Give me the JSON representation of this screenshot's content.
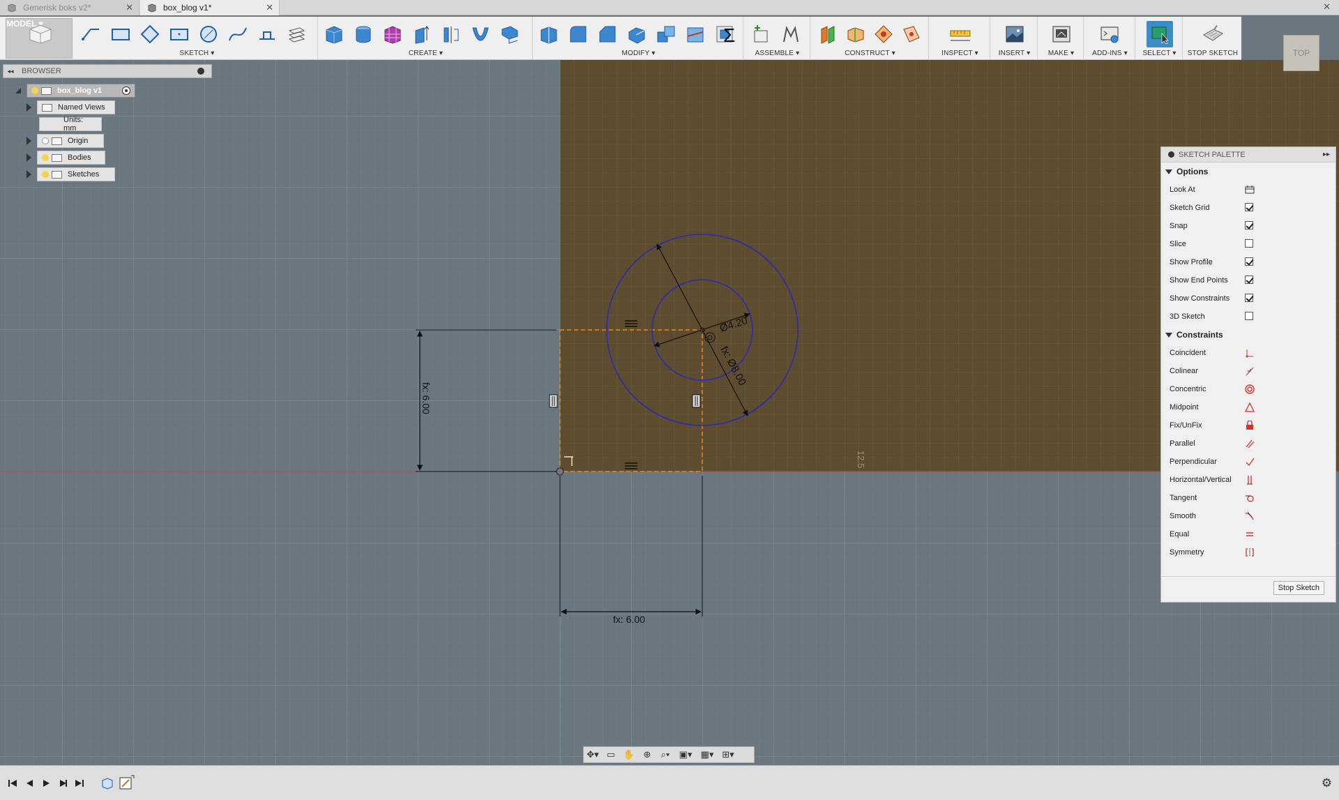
{
  "tabs": [
    {
      "label": "Generisk boks v2*",
      "active": false
    },
    {
      "label": "box_blog v1*",
      "active": true
    }
  ],
  "toolbar": {
    "groups": {
      "model": "MODEL ▾",
      "sketch": "SKETCH ▾",
      "create": "CREATE ▾",
      "modify": "MODIFY ▾",
      "assemble": "ASSEMBLE ▾",
      "construct": "CONSTRUCT ▾",
      "inspect": "INSPECT ▾",
      "insert": "INSERT ▾",
      "make": "MAKE ▾",
      "addins": "ADD-INS ▾",
      "select": "SELECT ▾",
      "stop_sketch": "STOP SKETCH"
    }
  },
  "viewcube": {
    "face": "TOP"
  },
  "browser": {
    "title": "BROWSER",
    "root": "box_blog v1",
    "items": [
      {
        "label": "Named Views"
      },
      {
        "label": "Units: mm"
      },
      {
        "label": "Origin"
      },
      {
        "label": "Bodies"
      },
      {
        "label": "Sketches"
      }
    ]
  },
  "sketch": {
    "dim_diameter_inner": "Ø4.20",
    "dim_diameter_outer": "fx: Ø8.00",
    "dim_vertical": "fx: 6.00",
    "dim_horizontal": "fx: 6.00",
    "grid_label": "12.5"
  },
  "palette": {
    "title": "SKETCH PALETTE",
    "options_title": "Options",
    "options": [
      {
        "label": "Look At",
        "type": "icon"
      },
      {
        "label": "Sketch Grid",
        "type": "check",
        "checked": true
      },
      {
        "label": "Snap",
        "type": "check",
        "checked": true
      },
      {
        "label": "Slice",
        "type": "check",
        "checked": false
      },
      {
        "label": "Show Profile",
        "type": "check",
        "checked": true
      },
      {
        "label": "Show End Points",
        "type": "check",
        "checked": true
      },
      {
        "label": "Show Constraints",
        "type": "check",
        "checked": true
      },
      {
        "label": "3D Sketch",
        "type": "check",
        "checked": false
      }
    ],
    "constraints_title": "Constraints",
    "constraints": [
      {
        "label": "Coincident",
        "icon": "coincident-icon"
      },
      {
        "label": "Colinear",
        "icon": "colinear-icon"
      },
      {
        "label": "Concentric",
        "icon": "concentric-icon"
      },
      {
        "label": "Midpoint",
        "icon": "midpoint-icon"
      },
      {
        "label": "Fix/UnFix",
        "icon": "lock-icon"
      },
      {
        "label": "Parallel",
        "icon": "parallel-icon"
      },
      {
        "label": "Perpendicular",
        "icon": "perpendicular-icon"
      },
      {
        "label": "Horizontal/Vertical",
        "icon": "horizontal-vertical-icon"
      },
      {
        "label": "Tangent",
        "icon": "tangent-icon"
      },
      {
        "label": "Smooth",
        "icon": "smooth-icon"
      },
      {
        "label": "Equal",
        "icon": "equal-icon"
      },
      {
        "label": "Symmetry",
        "icon": "symmetry-icon"
      }
    ],
    "stop_button": "Stop Sketch"
  },
  "colors": {
    "canvas": "#6b7780",
    "sketch_plane": "#5e4c2e",
    "circle": "#2a2ab5",
    "profile_dash": "#e08a2a",
    "constraint_red": "#d0342c"
  }
}
